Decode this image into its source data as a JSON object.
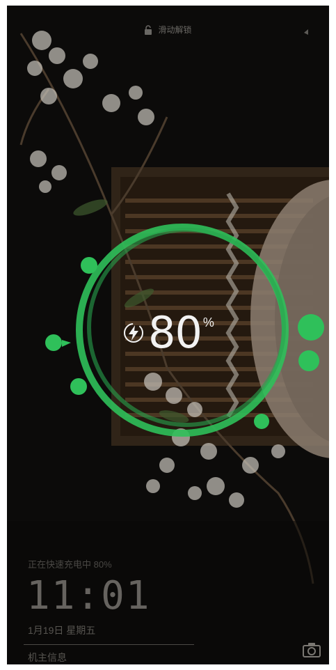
{
  "lockscreen": {
    "lock_text": "滑动解锁",
    "lock_icon": "lock-open-icon"
  },
  "charging": {
    "percent_value": "80",
    "percent_sign": "%",
    "bolt_icon": "super-charge-bolt-icon",
    "level": 0.8,
    "accent_color": "#2fc05a",
    "status_text": "正在快速充电中 80%"
  },
  "clock": {
    "time": "11:01",
    "date": "1月19日 星期五",
    "owner_info": "机主信息"
  },
  "shortcuts": {
    "camera_icon": "camera-icon"
  }
}
